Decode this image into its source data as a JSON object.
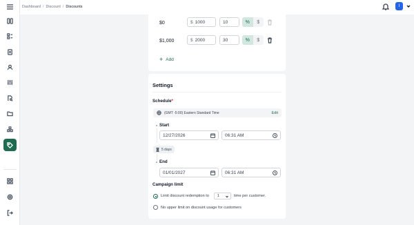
{
  "breadcrumb": {
    "items": [
      "Dashboard",
      "Discount",
      "Discounts"
    ],
    "separator": "/"
  },
  "header": {
    "avatar_letter": "I"
  },
  "sidebar": {
    "items": [
      "grid-icon",
      "tag-list-icon",
      "document-icon",
      "user-icon",
      "sliders-icon",
      "file-search-icon",
      "folder-icon",
      "boxes-icon",
      "discount-tag-icon",
      "apps-icon",
      "settings-icon",
      "logout-icon"
    ],
    "active": "discount-tag-icon"
  },
  "tiers": [
    {
      "label": "$0",
      "amount": "1000",
      "value": "10",
      "currency_prefix": "$"
    },
    {
      "label": "$1,000",
      "amount": "2000",
      "value": "30",
      "currency_prefix": "$"
    }
  ],
  "segment": {
    "percent_symbol": "%",
    "dollar_symbol": "$"
  },
  "add_label": "Add",
  "settings": {
    "title": "Settings",
    "schedule_label": "Schedule",
    "required_mark": "*",
    "timezone": "(GMT -5:00) Eastern Standard Time",
    "edit_label": "Edit",
    "start": {
      "label": "Start",
      "date": "12/27/2026",
      "time": "06:31 AM"
    },
    "duration": "5 days",
    "end": {
      "label": "End",
      "date": "01/01/2027",
      "time": "06:31 AM"
    },
    "campaign_limit_label": "Campaign limit",
    "limit_option_prefix": "Limit discount redemption to",
    "limit_count": "1",
    "limit_option_suffix": "time per customer.",
    "no_limit_option": "No upper limit on discount usage for customers"
  },
  "colors": {
    "accent": "#1e6b52",
    "accent_light": "#d1e7df",
    "avatar": "#2563eb",
    "required": "#dc2626"
  }
}
